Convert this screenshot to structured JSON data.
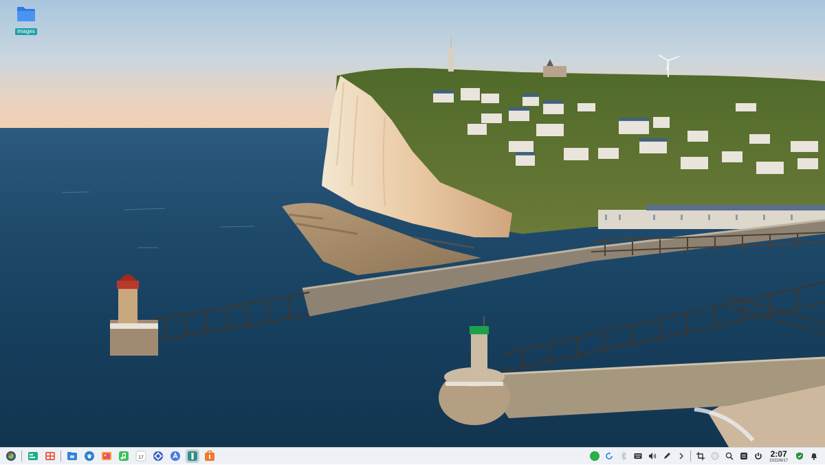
{
  "desktop": {
    "wallpaper": "coastal-cliff-harbor-wallpaper",
    "icons": [
      {
        "label": "images",
        "icon": "folder-icon",
        "color": "#2e7be6"
      }
    ]
  },
  "taskbar": {
    "background": "#eef1f5",
    "pinned_apps": [
      {
        "name": "launcher-icon"
      },
      {
        "name": "multitask-view-icon"
      },
      {
        "name": "workspace-grid-icon"
      },
      {
        "name": "file-manager-icon"
      },
      {
        "name": "browser-icon"
      },
      {
        "name": "photos-icon"
      },
      {
        "name": "music-icon"
      },
      {
        "name": "calendar-icon",
        "text": "17"
      },
      {
        "name": "settings-icon"
      },
      {
        "name": "app-store-icon"
      },
      {
        "name": "lighthouse-app-icon",
        "active": true
      },
      {
        "name": "shop-icon"
      }
    ],
    "tray": [
      "wechat-icon",
      "sync-icon",
      "bluetooth-icon",
      "keyboard-icon",
      "volume-icon",
      "pen-icon",
      "expand-arrow-icon",
      "screenshot-icon",
      "globe-icon",
      "search-icon",
      "notification-center-icon",
      "power-icon"
    ],
    "clock": {
      "time": "2:07",
      "date": "2022/6/17"
    }
  }
}
